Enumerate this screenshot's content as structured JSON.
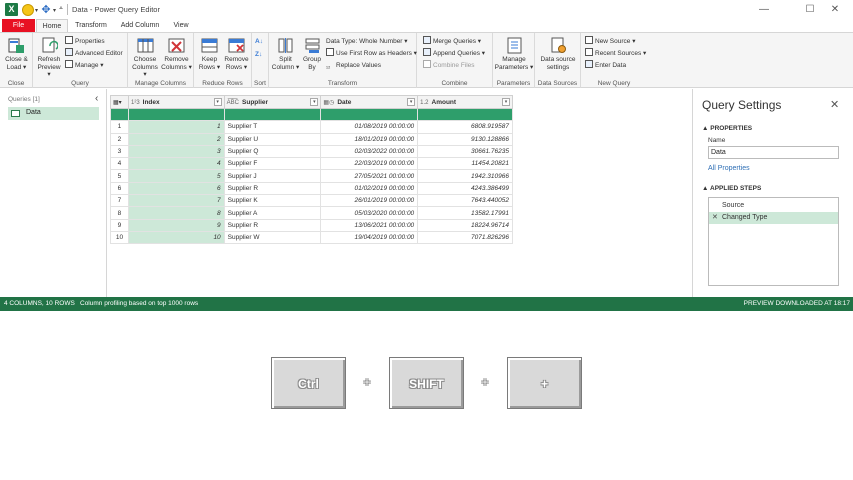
{
  "window": {
    "title": "Data - Power Query Editor",
    "minimize": "—",
    "maximize": "☐",
    "close": "✕"
  },
  "tabs": [
    {
      "label": "File"
    },
    {
      "label": "Home"
    },
    {
      "label": "Transform"
    },
    {
      "label": "Add Column"
    },
    {
      "label": "View"
    }
  ],
  "ribbon": {
    "close_load": "Close &\nLoad ▾",
    "refresh_preview": "Refresh\nPreview ▾",
    "properties": "Properties",
    "advanced_editor": "Advanced Editor",
    "manage": "Manage ▾",
    "choose_columns": "Choose\nColumns ▾",
    "remove_columns": "Remove\nColumns ▾",
    "keep_rows": "Keep\nRows ▾",
    "remove_rows": "Remove\nRows ▾",
    "split_column": "Split\nColumn ▾",
    "group_by": "Group\nBy",
    "data_type": "Data Type: Whole Number ▾",
    "first_row_headers": "Use First Row as Headers ▾",
    "replace_values": "Replace Values",
    "merge_queries": "Merge Queries ▾",
    "append_queries": "Append Queries ▾",
    "combine_files": "Combine Files",
    "manage_parameters": "Manage\nParameters ▾",
    "data_source_settings": "Data source\nsettings",
    "new_source": "New Source ▾",
    "recent_sources": "Recent Sources ▾",
    "enter_data": "Enter Data",
    "groups": {
      "close": "Close",
      "query": "Query",
      "manage_columns": "Manage Columns",
      "reduce_rows": "Reduce Rows",
      "sort": "Sort",
      "transform": "Transform",
      "combine": "Combine",
      "parameters": "Parameters",
      "data_sources": "Data Sources",
      "new_query": "New Query"
    }
  },
  "queries": {
    "title": "Queries [1]",
    "collapse": "‹",
    "items": [
      {
        "label": "Data"
      }
    ]
  },
  "grid": {
    "columns": [
      {
        "type": "1²3",
        "name": "Index"
      },
      {
        "type": "A͞B͞C",
        "name": "Supplier"
      },
      {
        "type": "",
        "name": "Date"
      },
      {
        "type": "1.2",
        "name": "Amount"
      }
    ],
    "rows": [
      {
        "n": "1",
        "index": "1",
        "supplier": "Supplier T",
        "date": "01/08/2019 00:00:00",
        "amount": "6808.919587"
      },
      {
        "n": "2",
        "index": "2",
        "supplier": "Supplier U",
        "date": "18/01/2019 00:00:00",
        "amount": "9130.128866"
      },
      {
        "n": "3",
        "index": "3",
        "supplier": "Supplier Q",
        "date": "02/03/2022 00:00:00",
        "amount": "30661.76235"
      },
      {
        "n": "4",
        "index": "4",
        "supplier": "Supplier F",
        "date": "22/03/2019 00:00:00",
        "amount": "11454.20821"
      },
      {
        "n": "5",
        "index": "5",
        "supplier": "Supplier J",
        "date": "27/05/2021 00:00:00",
        "amount": "1942.310966"
      },
      {
        "n": "6",
        "index": "6",
        "supplier": "Supplier R",
        "date": "01/02/2019 00:00:00",
        "amount": "4243.386499"
      },
      {
        "n": "7",
        "index": "7",
        "supplier": "Supplier K",
        "date": "26/01/2019 00:00:00",
        "amount": "7643.440052"
      },
      {
        "n": "8",
        "index": "8",
        "supplier": "Supplier A",
        "date": "05/03/2020 00:00:00",
        "amount": "13582.17991"
      },
      {
        "n": "9",
        "index": "9",
        "supplier": "Supplier R",
        "date": "13/06/2021 00:00:00",
        "amount": "18224.96714"
      },
      {
        "n": "10",
        "index": "10",
        "supplier": "Supplier W",
        "date": "19/04/2019 00:00:00",
        "amount": "7071.826296"
      }
    ]
  },
  "settings": {
    "title": "Query Settings",
    "close": "✕",
    "properties_heading": "▲ PROPERTIES",
    "name_label": "Name",
    "name_value": "Data",
    "all_properties": "All Properties",
    "steps_heading": "▲ APPLIED STEPS",
    "steps": [
      {
        "label": "Source",
        "marker": ""
      },
      {
        "label": "Changed Type",
        "marker": "✕"
      }
    ]
  },
  "status": {
    "columns_rows": "4 COLUMNS, 10 ROWS",
    "profiling": "Column profiling based on top 1000 rows",
    "preview": "PREVIEW DOWNLOADED AT 18:17"
  },
  "keystrokes": {
    "key1": "Ctrl",
    "key2": "SHIFT",
    "key3": "+",
    "plus": "+"
  },
  "colors": {
    "accent": "#217346",
    "file_tab": "#e81123",
    "selection": "#cde8d8"
  }
}
